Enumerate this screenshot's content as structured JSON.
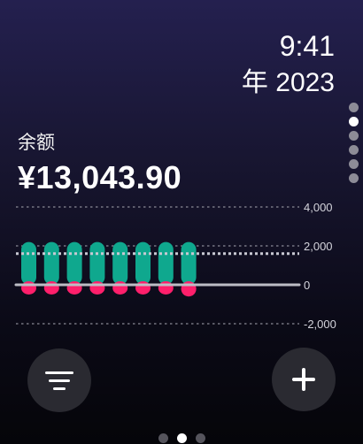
{
  "status": {
    "time": "9:41",
    "year": "年 2023"
  },
  "balance": {
    "label": "余额",
    "amount": "¥13,043.90"
  },
  "side_pager": {
    "count": 6,
    "active_index": 1
  },
  "bottom_pager": {
    "count": 3,
    "active_index": 1
  },
  "buttons": {
    "filter": {
      "icon": "filter-lines-icon"
    },
    "add": {
      "icon": "plus-icon"
    }
  },
  "colors": {
    "income": "#0fa88e",
    "expense": "#ff1f6b",
    "grid": "#8a8a96",
    "baseline": "#bdbdc5",
    "average_line": "#c9c9d3"
  },
  "chart_data": {
    "type": "bar",
    "ylim": [
      -2000,
      4000
    ],
    "yticks": [
      4000,
      2000,
      0,
      -2000
    ],
    "ytick_labels": [
      "4,000",
      "2,000",
      "0",
      "-2,000"
    ],
    "average": 1600,
    "series": [
      {
        "values": [
          2200,
          2200,
          2200,
          2200,
          2200,
          2200,
          2200,
          2200
        ]
      },
      {
        "values": [
          -500,
          -500,
          -500,
          -500,
          -500,
          -500,
          -500,
          -600
        ]
      }
    ]
  }
}
